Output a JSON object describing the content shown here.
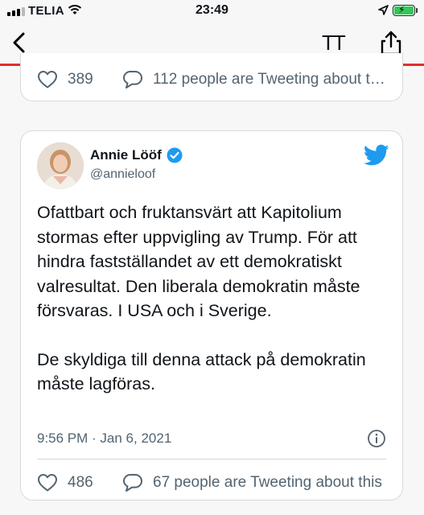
{
  "status_bar": {
    "carrier": "TELIA",
    "time": "23:49"
  },
  "nav": {
    "text_size_label": "TT"
  },
  "top_tweet": {
    "like_count": "389",
    "conversation_text": "112 people are Tweeting about this"
  },
  "tweet": {
    "author_name": "Annie Lööf",
    "author_handle": "@annieloof",
    "paragraph_1": "Ofattbart och fruktansvärt att Kapitolium stormas efter uppvigling av Trump. För att hindra fastställandet av ett demokratiskt valresultat. Den liberala demokratin måste försvaras. I USA och i Sverige.",
    "paragraph_2": "De skyldiga till denna attack på demokratin måste lagföras.",
    "timestamp": "9:56 PM · Jan 6, 2021",
    "like_count": "486",
    "conversation_text": "67 people are Tweeting about this"
  },
  "colors": {
    "twitter_blue": "#1d9bf0",
    "accent_red_line": "#e0302f",
    "battery_green": "#34c759",
    "secondary_text": "#536471"
  },
  "icons": [
    "signal-icon",
    "wifi-icon",
    "location-icon",
    "battery-icon",
    "back-icon",
    "share-icon",
    "heart-icon",
    "reply-bubble-icon",
    "verified-badge-icon",
    "twitter-bird-icon",
    "info-icon"
  ]
}
